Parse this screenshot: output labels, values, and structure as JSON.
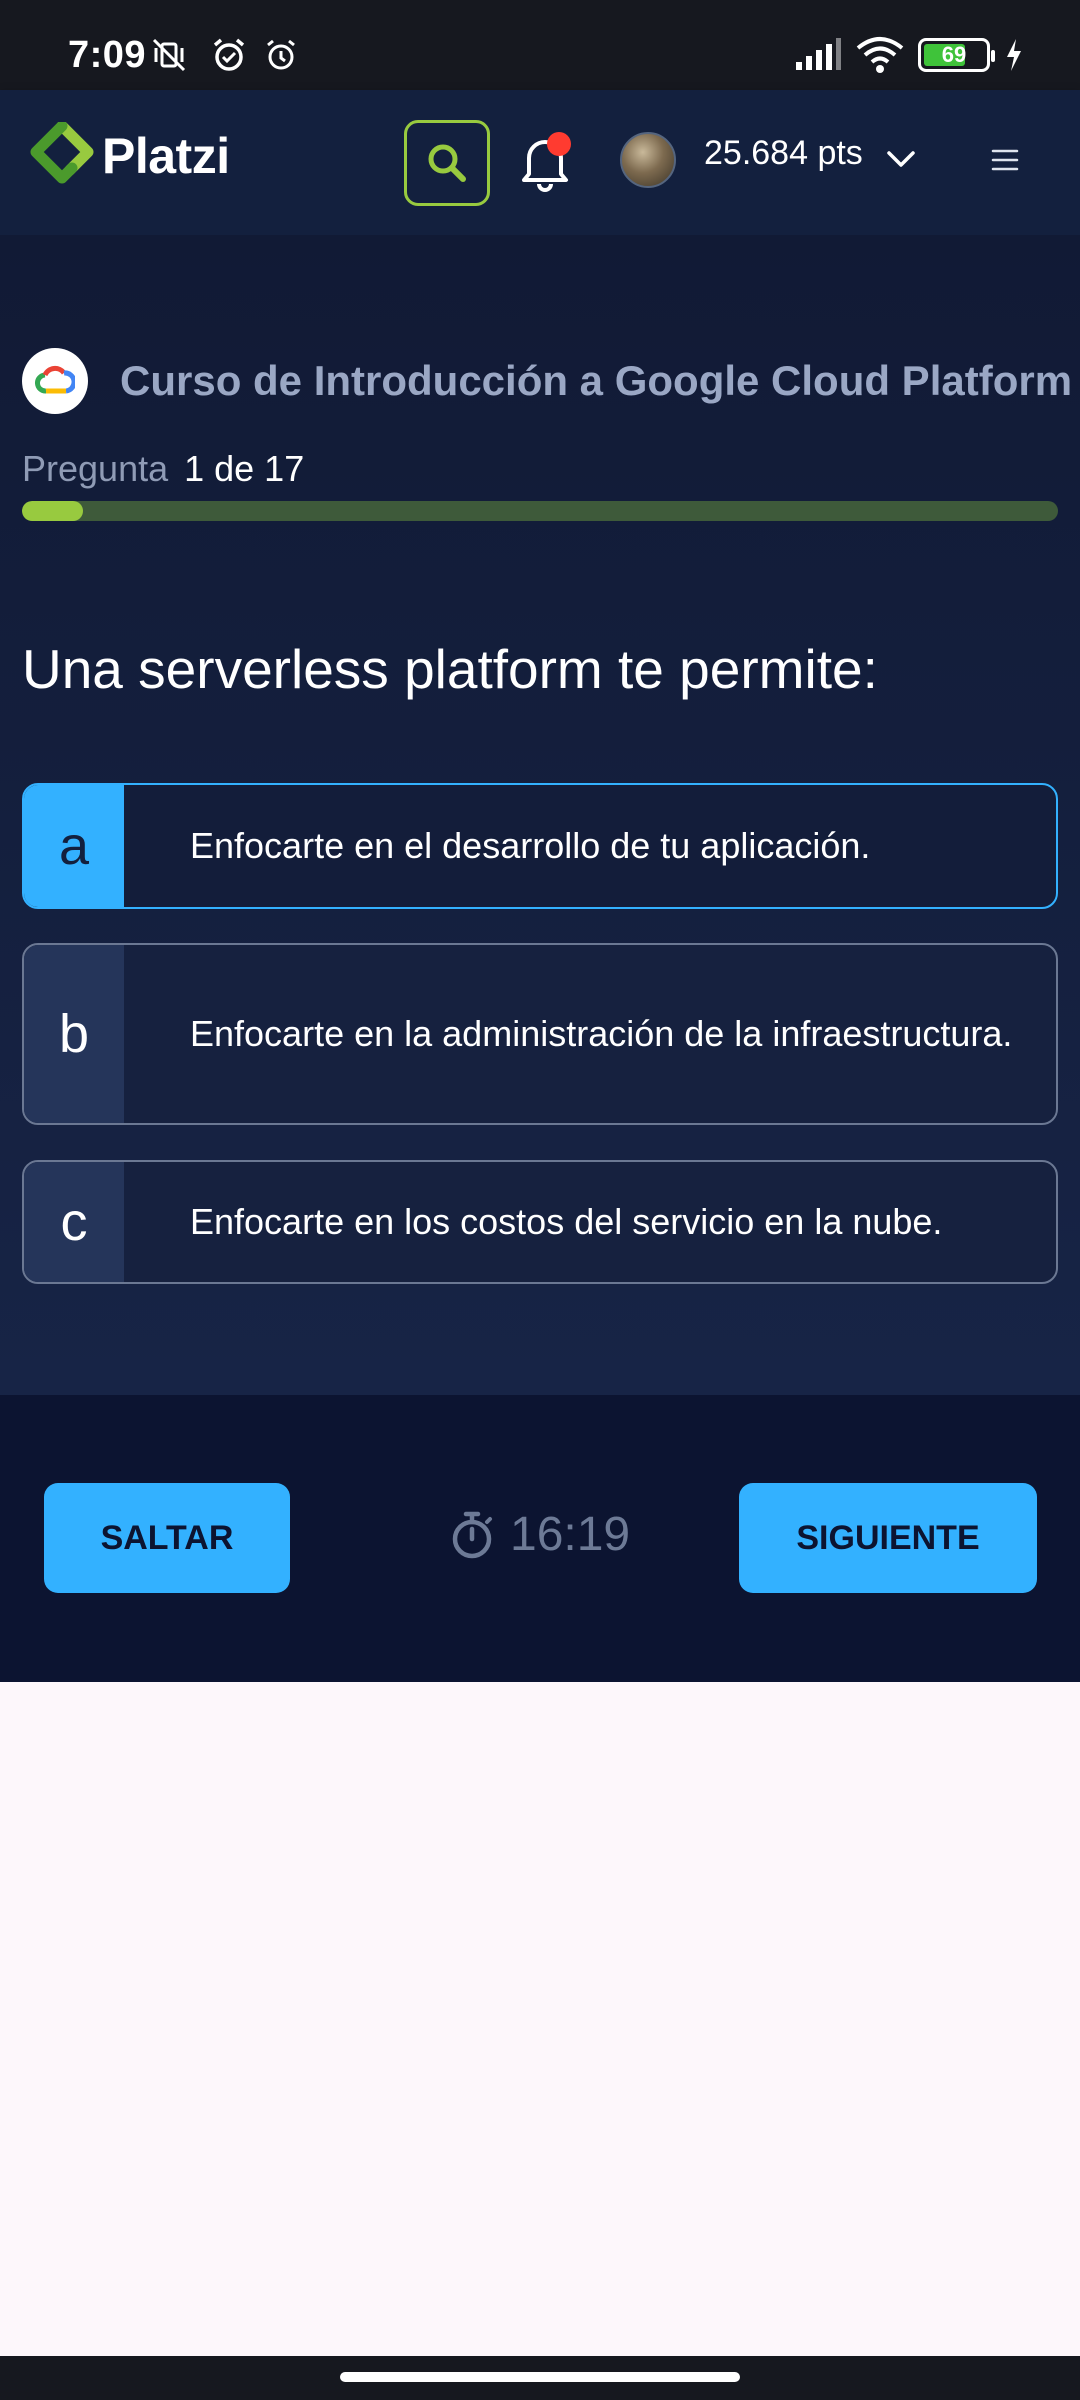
{
  "status_bar": {
    "time": "7:09",
    "battery": "69",
    "icons": [
      "vibrate-off-icon",
      "alarm-icon",
      "alarm-icon",
      "signal-icon",
      "wifi-icon",
      "battery-icon",
      "charging-icon"
    ]
  },
  "header": {
    "logo_text": "Platzi",
    "points": "25.684 pts",
    "icons": [
      "platzi-logo-icon",
      "search-icon",
      "bell-icon",
      "avatar",
      "chevron-down-icon",
      "menu-icon"
    ],
    "notification_dot_color": "#ff3b30"
  },
  "quiz": {
    "course_title": "Curso de Introducción a Google Cloud Platform",
    "progress_label": "Pregunta",
    "progress_value": "1 de 17",
    "progress_fraction": 0.059,
    "question": "Una serverless platform te permite:",
    "options": [
      {
        "letter": "a",
        "text": "Enfocarte en el desarrollo de tu aplicación.",
        "selected": true
      },
      {
        "letter": "b",
        "text": "Enfocarte en la administración de la infraestructura.",
        "selected": false
      },
      {
        "letter": "c",
        "text": "Enfocarte en los costos del servicio en la nube.",
        "selected": false
      }
    ]
  },
  "footer": {
    "skip_label": "SALTAR",
    "next_label": "SIGUIENTE",
    "timer": "16:19",
    "icons": [
      "stopwatch-icon"
    ]
  },
  "colors": {
    "accent_blue": "#33b1ff",
    "accent_green": "#98ca3f",
    "header_bg": "#13203e",
    "quiz_bg": "#111a35",
    "footer_bg": "#0c1431"
  }
}
